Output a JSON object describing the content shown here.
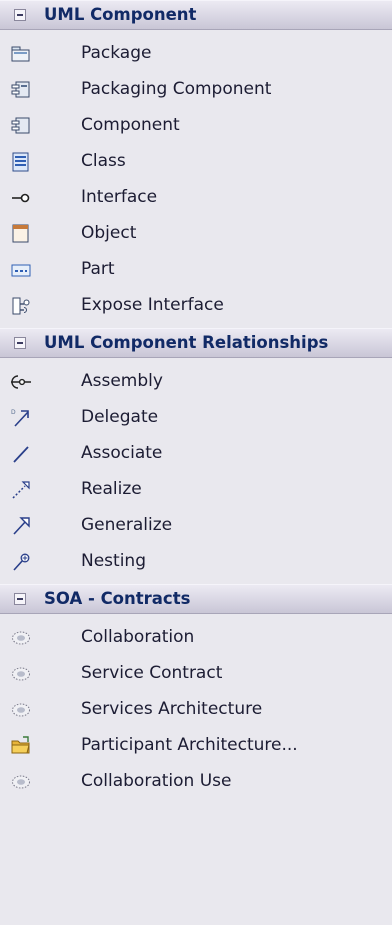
{
  "sections": [
    {
      "title": "UML Component",
      "items": [
        {
          "label": "Package",
          "icon": "package-icon"
        },
        {
          "label": "Packaging Component",
          "icon": "packaging-component-icon"
        },
        {
          "label": "Component",
          "icon": "component-icon"
        },
        {
          "label": "Class",
          "icon": "class-icon"
        },
        {
          "label": "Interface",
          "icon": "interface-icon"
        },
        {
          "label": "Object",
          "icon": "object-icon"
        },
        {
          "label": "Part",
          "icon": "part-icon"
        },
        {
          "label": "Expose Interface",
          "icon": "expose-interface-icon"
        }
      ]
    },
    {
      "title": "UML Component Relationships",
      "items": [
        {
          "label": "Assembly",
          "icon": "assembly-icon"
        },
        {
          "label": "Delegate",
          "icon": "delegate-icon"
        },
        {
          "label": "Associate",
          "icon": "associate-icon"
        },
        {
          "label": "Realize",
          "icon": "realize-icon"
        },
        {
          "label": "Generalize",
          "icon": "generalize-icon"
        },
        {
          "label": "Nesting",
          "icon": "nesting-icon"
        }
      ]
    },
    {
      "title": "SOA - Contracts",
      "items": [
        {
          "label": "Collaboration",
          "icon": "collaboration-icon"
        },
        {
          "label": "Service Contract",
          "icon": "service-contract-icon"
        },
        {
          "label": "Services Architecture",
          "icon": "services-architecture-icon"
        },
        {
          "label": "Participant Architecture...",
          "icon": "participant-architecture-icon"
        },
        {
          "label": "Collaboration Use",
          "icon": "collaboration-use-icon"
        }
      ]
    }
  ]
}
